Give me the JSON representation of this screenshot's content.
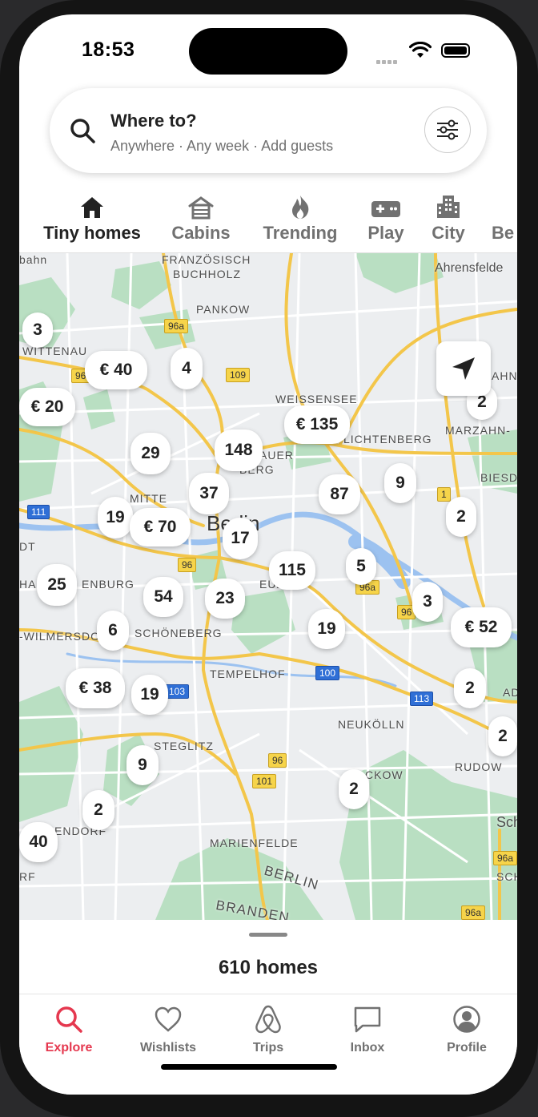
{
  "status": {
    "time": "18:53"
  },
  "search": {
    "title": "Where to?",
    "subtitle": "Anywhere · Any week · Add guests"
  },
  "categories": [
    {
      "label": "Tiny homes",
      "icon": "house-icon",
      "active": true
    },
    {
      "label": "Cabins",
      "icon": "cabin-icon"
    },
    {
      "label": "Trending",
      "icon": "flame-icon"
    },
    {
      "label": "Play",
      "icon": "gamepad-icon"
    },
    {
      "label": "City",
      "icon": "buildings-icon"
    },
    {
      "label": "Be",
      "icon": "beach-icon"
    }
  ],
  "map": {
    "labels": {
      "bahn": "bahn",
      "franz1": "FRANZÖSISCH",
      "franz2": "BUCHHOLZ",
      "ahrensfelde": "Ahrensfelde",
      "pankow": "PANKOW",
      "wittenau": "WITTENAU",
      "ahn": "AHN",
      "weissensee": "WEISSENSEE",
      "marzahn": "MARZAHN-",
      "lichtenberg": "LICHTENBERG",
      "auer": "AUER",
      "berg": "BERG",
      "biesd": "BIESD",
      "mitte": "MITTE",
      "berlin_city": "Berlin",
      "dt": "DT",
      "ha": "HA",
      "enburg": "ENBURG",
      "kreuzberg": "EUZB",
      "wilmersdorf": "-WILMERSDO",
      "schoeneberg": "SCHÖNEBERG",
      "tempelhof": "TEMPELHOF",
      "ad": "AD",
      "neukoelln": "NEUKÖLLN",
      "steglitz": "STEGLITZ",
      "buckow": "CKOW",
      "rudow": "RUDOW",
      "sch1": "Sch",
      "endorf": "ENDORF",
      "rf": "RF",
      "marienfelde": "MARIENFELDE",
      "berlin_state": "BERLIN",
      "sch2": "SCH",
      "brandenburg": "BRANDEN"
    },
    "shields": [
      "96a",
      "96",
      "109",
      "111",
      "96",
      "96a",
      "96",
      "1",
      "100",
      "113",
      "103",
      "96",
      "101",
      "96a",
      "96a"
    ],
    "pins": [
      "3",
      "€ 40",
      "4",
      "€ 20",
      "2",
      "€ 135",
      "29",
      "148",
      "9",
      "37",
      "87",
      "2",
      "19",
      "€ 70",
      "17",
      "25",
      "115",
      "5",
      "54",
      "23",
      "3",
      "6",
      "19",
      "€ 52",
      "€ 38",
      "19",
      "2",
      "2",
      "9",
      "2",
      "2",
      "40"
    ]
  },
  "sheet": {
    "count_label": "610 homes"
  },
  "tabs": [
    {
      "label": "Explore",
      "icon": "search-icon",
      "active": true
    },
    {
      "label": "Wishlists",
      "icon": "heart-icon"
    },
    {
      "label": "Trips",
      "icon": "airbnb-logo-icon"
    },
    {
      "label": "Inbox",
      "icon": "message-icon"
    },
    {
      "label": "Profile",
      "icon": "profile-icon"
    }
  ],
  "colors": {
    "accent": "#E5384F",
    "map_bg": "#ECEEF0",
    "park": "#B9DFC2",
    "road": "#F3C64A",
    "water": "#9CC2F0"
  }
}
